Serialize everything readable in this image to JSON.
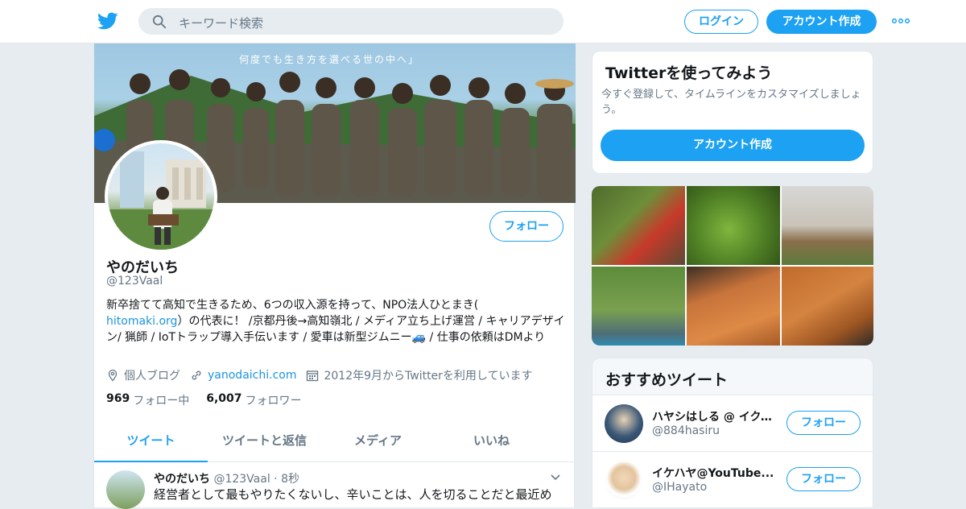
{
  "header": {
    "search_placeholder": "キーワード検索",
    "login_label": "ログイン",
    "signup_label": "アカウント作成"
  },
  "profile": {
    "banner_caption": "何度でも生き方を選べる世の中へ」",
    "follow_label": "フォロー",
    "name": "やのだいち",
    "handle": "@123Vaal",
    "bio_1": "新卒捨てて高知で生きるため、6つの収入源を持って、NPO法人ひとまき(",
    "bio_link": "hitomaki.org",
    "bio_2": "）の代表に！ /京都丹後→高知嶺北 / メディア立ち上げ運営 / キャリアデザイン/ 猟師 / IoTトラップ導入手伝います / 愛車は新型ジムニー🚙 / 仕事の依頼はDMより",
    "location": "個人ブログ",
    "url": "yanodaichi.com",
    "joined": "2012年9月からTwitterを利用しています",
    "following_count": "969",
    "following_label": "フォロー中",
    "followers_count": "6,007",
    "followers_label": "フォロワー",
    "tabs": [
      "ツイート",
      "ツイートと返信",
      "メディア",
      "いいね"
    ]
  },
  "tweet": {
    "name": "やのだいち",
    "handle": "@123Vaal",
    "time": "· 8秒",
    "text": "経営者として最もやりたくないし、辛いことは、人を切ることだと最近め"
  },
  "sidebar": {
    "try_title": "Twitterを使ってみよう",
    "try_text": "今すぐ登録して、タイムラインをカスタマイズしましょう。",
    "try_button": "アカウント作成",
    "reco_title": "おすすめツイート",
    "reco": [
      {
        "name": "ハヤシはしる @ イクメン...",
        "handle": "@884hasiru",
        "button": "フォロー"
      },
      {
        "name": "イケハヤ@YouTube...",
        "handle": "@IHayato",
        "button": "フォロー"
      }
    ]
  },
  "colors": {
    "accent": "#1da1f2",
    "link": "#1b95e0",
    "muted": "#657786",
    "bg": "#e6ecf0"
  }
}
